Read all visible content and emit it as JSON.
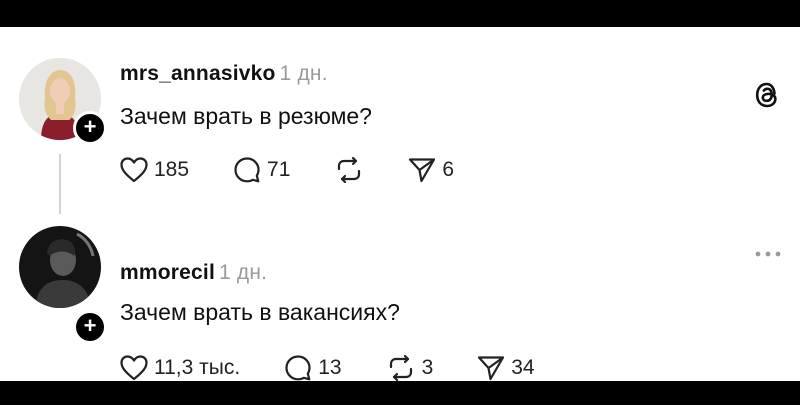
{
  "posts": [
    {
      "username": "mrs_annasivko",
      "time": "1 дн.",
      "text": "Зачем врать в резюме?",
      "likes": "185",
      "comments": "71",
      "reposts": "",
      "shares": "6"
    },
    {
      "username": "mmorecil",
      "time": "1 дн.",
      "text": "Зачем врать в вакансиях?",
      "likes": "11,3 тыс.",
      "comments": "13",
      "reposts": "3",
      "shares": "34"
    }
  ],
  "follow_symbol": "+",
  "icons": {
    "app": "threads-logo-icon",
    "like": "heart-icon",
    "comment": "comment-bubble-icon",
    "repost": "repost-icon",
    "share": "send-icon",
    "more": "more-dots-icon"
  }
}
